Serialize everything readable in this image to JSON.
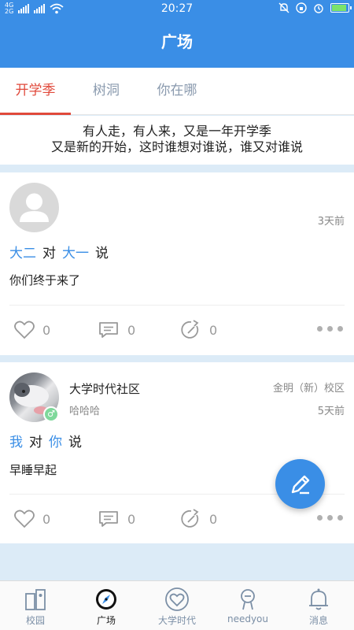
{
  "status": {
    "network_top": "4G",
    "network_bottom": "2G",
    "time": "20:27"
  },
  "header": {
    "title": "广场"
  },
  "tabs": [
    {
      "label": "开学季",
      "active": true
    },
    {
      "label": "树洞",
      "active": false
    },
    {
      "label": "你在哪",
      "active": false
    }
  ],
  "banner": {
    "line1": "有人走，有人来，又是一年开学季",
    "line2": "又是新的开始，这时谁想对谁说，谁又对谁说"
  },
  "posts": [
    {
      "avatar": "default-avatar",
      "time": "3天前",
      "from": "大二",
      "to_word": "对",
      "to": "大一",
      "say_word": "说",
      "content": "你们终于来了",
      "likes": "0",
      "comments": "0",
      "shares": "0"
    },
    {
      "avatar": "cat-photo",
      "gender_icon": "male-icon",
      "name": "大学时代社区",
      "nickname": "哈哈哈",
      "campus": "金明（新）校区",
      "time": "5天前",
      "from": "我",
      "to_word": "对",
      "to": "你",
      "say_word": "说",
      "content": "早睡早起",
      "likes": "0",
      "comments": "0",
      "shares": "0"
    }
  ],
  "bottom_nav": [
    {
      "label": "校园",
      "icon": "campus-icon",
      "active": false
    },
    {
      "label": "广场",
      "icon": "compass-icon",
      "active": true
    },
    {
      "label": "大学时代",
      "icon": "heart-badge-icon",
      "active": false
    },
    {
      "label": "needyou",
      "icon": "person-icon",
      "active": false
    },
    {
      "label": "消息",
      "icon": "bell-icon",
      "active": false
    }
  ],
  "colors": {
    "primary": "#3a8ee6",
    "active_tab": "#e0493b",
    "background": "#dcebf7"
  }
}
